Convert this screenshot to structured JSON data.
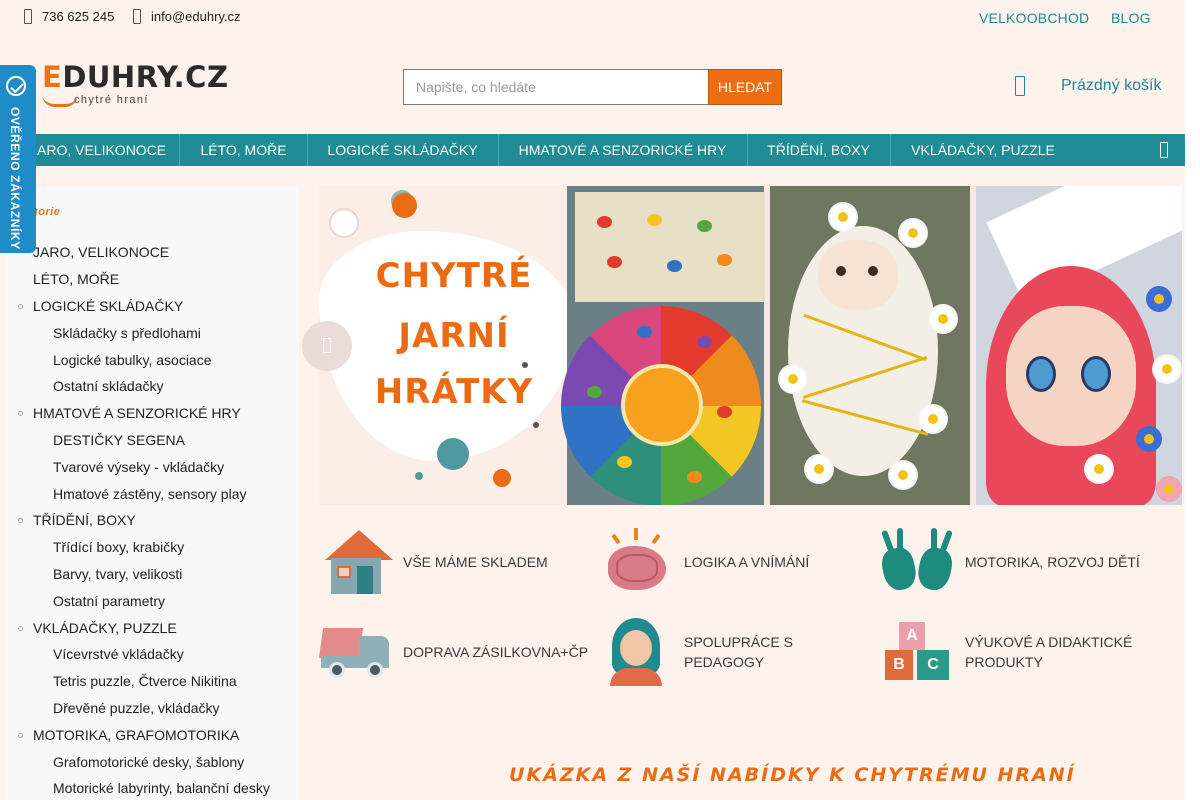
{
  "contact": {
    "phone": "736 625 245",
    "email": "info@eduhry.cz"
  },
  "top_links": {
    "wholesale": "VELKOOBCHOD",
    "blog": "BLOG"
  },
  "logo": {
    "first_letter": "E",
    "rest": "DUHRY.CZ",
    "tagline": "chytré hraní"
  },
  "search": {
    "placeholder": "Napište, co hledáte",
    "button": "HLEDAT"
  },
  "cart": {
    "label": "Prázdný košík",
    "icon": "shopping-bag-icon"
  },
  "nav": {
    "items": [
      "JARO, VELIKONOCE",
      "LÉTO, MOŘE",
      "LOGICKÉ SKLÁDAČKY",
      "HMATOVÉ A SENZORICKÉ HRY",
      "TŘÍDĚNÍ, BOXY",
      "VKLÁDAČKY, PUZZLE"
    ],
    "more_icon": "menu-icon"
  },
  "badge": {
    "text": "OVĚŘENO ZÁKAZNÍKY"
  },
  "sidebar": {
    "heading": "gorie",
    "categories": [
      "JARO, VELIKONOCE",
      "LÉTO, MOŘE",
      "LOGICKÉ SKLÁDAČKY",
      "Skládačky s předlohami",
      "Logické tabulky, asociace",
      "Ostatní skládačky",
      "HMATOVÉ A SENZORICKÉ HRY",
      "DESTIČKY SEGENA",
      "Tvarové výseky - vkládačky",
      "Hmatové zástěny, sensory play",
      "TŘÍDĚNÍ, BOXY",
      "Třídící boxy, krabičky",
      "Barvy, tvary, velikosti",
      "Ostatní parametry",
      "VKLÁDAČKY, PUZZLE",
      "Vícevrstvé vkládačky",
      "Tetris puzzle, Čtverce Nikitina",
      "Dřevěné puzzle, vkládačky",
      "MOTORIKA, GRAFOMOTORIKA",
      "Grafomotorické desky, šablony",
      "Motorické labyrinty, balanční desky"
    ]
  },
  "banner": {
    "lines": [
      "CHYTRÉ",
      "JARNÍ",
      "HRÁTKY"
    ]
  },
  "features": [
    {
      "text": "VŠE MÁME SKLADEM",
      "icon": "house-icon"
    },
    {
      "text": "LOGIKA A VNÍMÁNÍ",
      "icon": "brain-icon"
    },
    {
      "text": "MOTORIKA, ROZVOJ DĚTÍ",
      "icon": "hands-icon"
    },
    {
      "text": "DOPRAVA ZÁSILKOVNA+ČP",
      "icon": "truck-icon"
    },
    {
      "text": "SPOLUPRÁCE S PEDAGOGY",
      "icon": "teacher-icon"
    },
    {
      "text": "VÝUKOVÉ A DIDAKTICKÉ PRODUKTY",
      "icon": "abc-blocks-icon"
    }
  ],
  "promo_heading": "UKÁZKA Z NAŠÍ NABÍDKY K CHYTRÉMU HRANÍ",
  "colors": {
    "accent": "#ec6d12",
    "teal": "#1e8b95",
    "badge_blue": "#1f8cc8",
    "background": "#fdf2ec"
  }
}
